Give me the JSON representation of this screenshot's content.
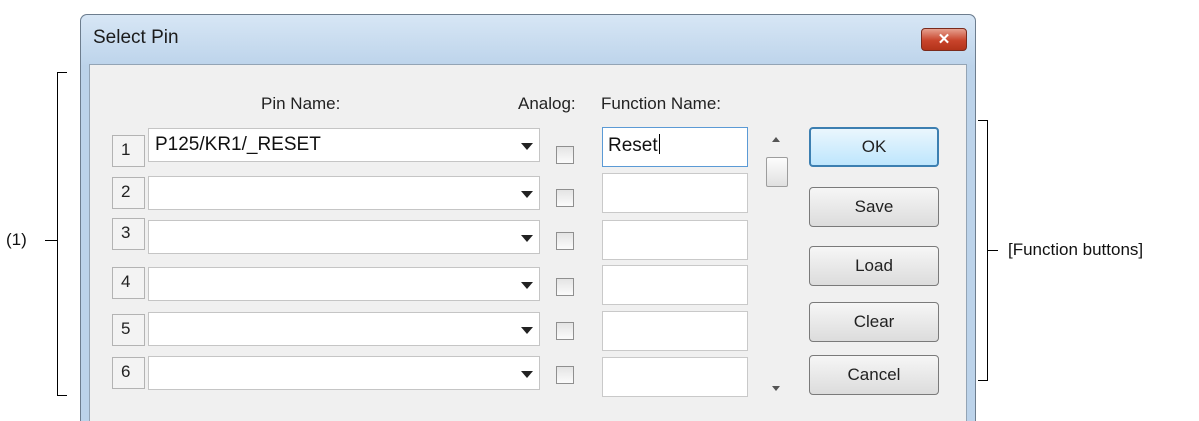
{
  "window": {
    "title": "Select Pin",
    "close_glyph": "✕"
  },
  "headers": {
    "pin_name": "Pin Name:",
    "analog": "Analog:",
    "function_name": "Function Name:"
  },
  "rows": [
    {
      "num": "1",
      "pin": "P125/KR1/_RESET",
      "analog_checked": false,
      "function": "Reset"
    },
    {
      "num": "2",
      "pin": "",
      "analog_checked": false,
      "function": ""
    },
    {
      "num": "3",
      "pin": "",
      "analog_checked": false,
      "function": ""
    },
    {
      "num": "4",
      "pin": "",
      "analog_checked": false,
      "function": ""
    },
    {
      "num": "5",
      "pin": "",
      "analog_checked": false,
      "function": ""
    },
    {
      "num": "6",
      "pin": "",
      "analog_checked": false,
      "function": ""
    }
  ],
  "buttons": {
    "ok": "OK",
    "save": "Save",
    "load": "Load",
    "clear": "Clear",
    "cancel": "Cancel"
  },
  "annotations": {
    "left": "(1)",
    "right": "[Function buttons]"
  },
  "colors": {
    "accent": "#3c7fb1",
    "close_button": "#c8442b",
    "title_bar": "#bdd4eb"
  }
}
